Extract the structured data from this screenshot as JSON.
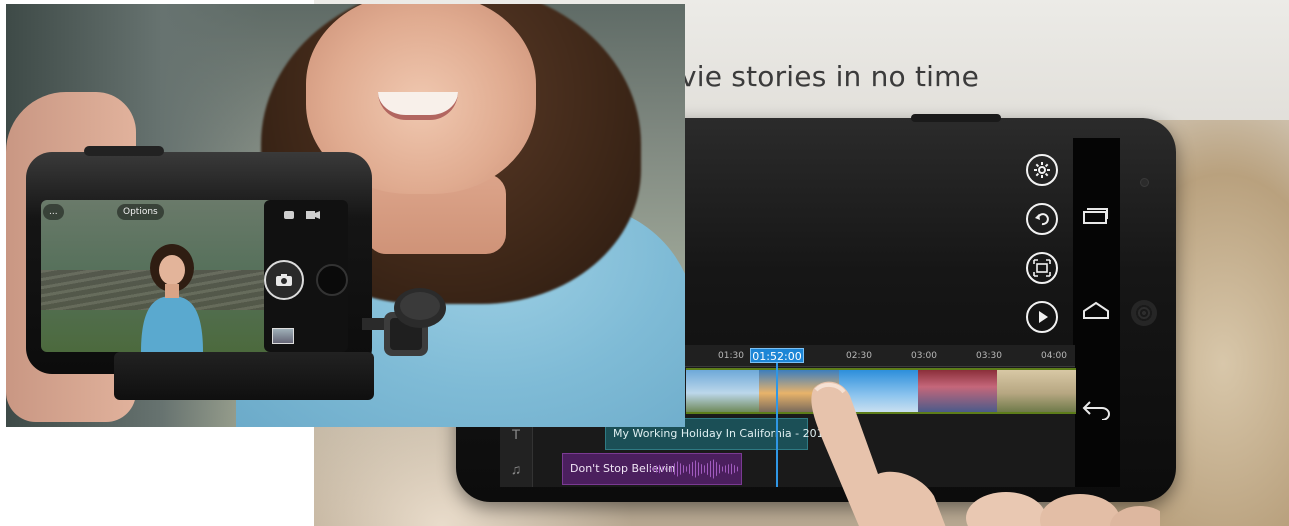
{
  "promo": {
    "tagline": "vie stories in no time"
  },
  "editor": {
    "playhead_time": "01:52:00",
    "ruler_ticks": [
      "01:30",
      "02:30",
      "03:00",
      "03:30",
      "04:00"
    ],
    "title_clip": "My Working Holiday In California - 2013",
    "music_clip": "Don't Stop Believin",
    "side_controls": [
      "settings-icon",
      "undo-icon",
      "fullscreen-icon",
      "play-icon"
    ],
    "nav_keys": [
      "recent-apps-icon",
      "home-icon",
      "back-icon"
    ],
    "accent": "#1d86d6",
    "title_track_color": "#1b4f56",
    "music_track_color": "#4b1f5e"
  },
  "rig_camera": {
    "option_left": "...",
    "option_mid": "Options",
    "icons": [
      "camera-icon",
      "video-icon"
    ]
  }
}
